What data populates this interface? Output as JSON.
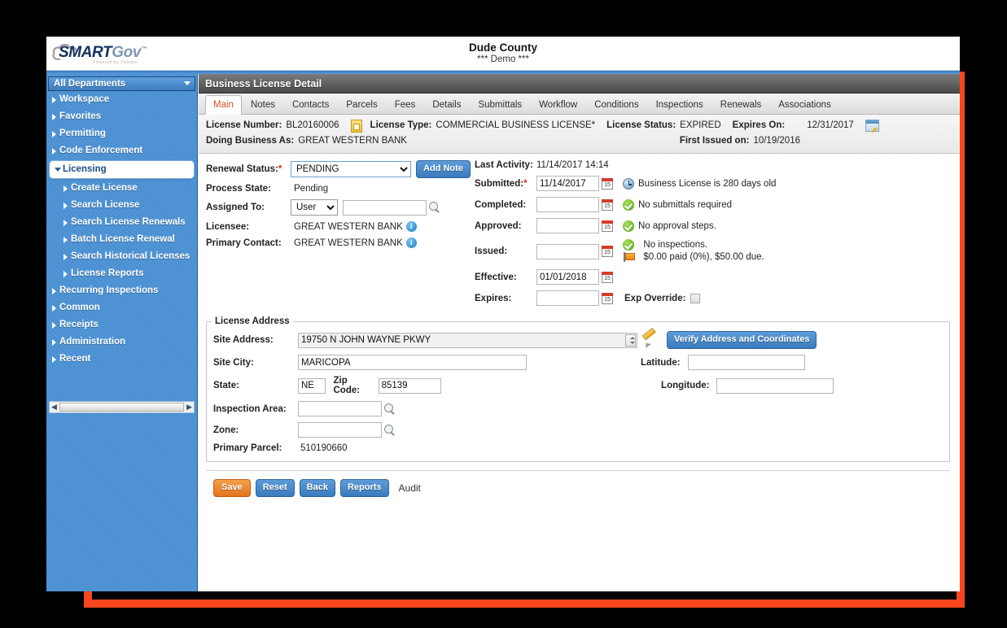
{
  "frame": {
    "accent_color": "#f9461c",
    "backdrop_color": "#000000"
  },
  "brand": {
    "logo_smart": "SMART",
    "logo_gov": "Gov",
    "logo_tm": "™",
    "logo_tagline": "Powered by Paladin"
  },
  "header": {
    "county": "Dude County",
    "demo": "*** Demo ***"
  },
  "sidebar": {
    "dept_selector": "All Departments",
    "items": [
      {
        "label": "Workspace",
        "level": 1,
        "state": "collapsed"
      },
      {
        "label": "Favorites",
        "level": 1,
        "state": "collapsed"
      },
      {
        "label": "Permitting",
        "level": 1,
        "state": "collapsed"
      },
      {
        "label": "Code Enforcement",
        "level": 1,
        "state": "collapsed"
      },
      {
        "label": "Licensing",
        "level": 1,
        "state": "expanded"
      },
      {
        "label": "Create License",
        "level": 2,
        "state": "collapsed"
      },
      {
        "label": "Search License",
        "level": 2,
        "state": "collapsed"
      },
      {
        "label": "Search License Renewals",
        "level": 2,
        "state": "collapsed"
      },
      {
        "label": "Batch License Renewal",
        "level": 2,
        "state": "collapsed"
      },
      {
        "label": "Search Historical Licenses",
        "level": 2,
        "state": "collapsed"
      },
      {
        "label": "License Reports",
        "level": 2,
        "state": "collapsed"
      },
      {
        "label": "Recurring Inspections",
        "level": 1,
        "state": "collapsed"
      },
      {
        "label": "Common",
        "level": 1,
        "state": "collapsed"
      },
      {
        "label": "Receipts",
        "level": 1,
        "state": "collapsed"
      },
      {
        "label": "Administration",
        "level": 1,
        "state": "collapsed"
      },
      {
        "label": "Recent",
        "level": 1,
        "state": "collapsed"
      }
    ]
  },
  "panel": {
    "title": "Business License Detail",
    "tabs": [
      {
        "label": "Main",
        "active": true
      },
      {
        "label": "Notes",
        "active": false
      },
      {
        "label": "Contacts",
        "active": false
      },
      {
        "label": "Parcels",
        "active": false
      },
      {
        "label": "Fees",
        "active": false
      },
      {
        "label": "Details",
        "active": false
      },
      {
        "label": "Submittals",
        "active": false
      },
      {
        "label": "Workflow",
        "active": false
      },
      {
        "label": "Conditions",
        "active": false
      },
      {
        "label": "Inspections",
        "active": false
      },
      {
        "label": "Renewals",
        "active": false
      },
      {
        "label": "Associations",
        "active": false
      }
    ]
  },
  "license_header": {
    "license_number_label": "License Number:",
    "license_number": "BL20160006",
    "license_type_label": "License Type:",
    "license_type": "COMMERCIAL BUSINESS LICENSE*",
    "license_status_label": "License Status:",
    "license_status": "EXPIRED",
    "expires_on_label": "Expires On:",
    "expires_on": "12/31/2017",
    "dba_label": "Doing Business As:",
    "dba": "GREAT WESTERN BANK",
    "first_issued_label": "First Issued on:",
    "first_issued": "10/19/2016"
  },
  "main_form": {
    "renewal_status_label": "Renewal Status:",
    "renewal_status_value": "PENDING",
    "renewal_status_options": [
      "PENDING"
    ],
    "add_note_button": "Add Note",
    "process_state_label": "Process State:",
    "process_state_value": "Pending",
    "assigned_to_label": "Assigned To:",
    "assigned_to_type": "User",
    "assigned_to_type_options": [
      "User"
    ],
    "assigned_to_value": "",
    "licensee_label": "Licensee:",
    "licensee_value": "GREAT WESTERN BANK",
    "primary_contact_label": "Primary Contact:",
    "primary_contact_value": "GREAT WESTERN BANK"
  },
  "dates": {
    "last_activity_label": "Last Activity:",
    "last_activity_value": "11/14/2017 14:14",
    "submitted_label": "Submitted:",
    "submitted_value": "11/14/2017",
    "submitted_note": "Business License is 280 days old",
    "completed_label": "Completed:",
    "completed_value": "",
    "completed_note": "No submittals required",
    "approved_label": "Approved:",
    "approved_value": "",
    "approved_note": "No approval steps.",
    "issued_label": "Issued:",
    "issued_value": "",
    "issued_note_1": "No inspections.",
    "issued_note_2": "$0.00 paid (0%), $50.00 due.",
    "effective_label": "Effective:",
    "effective_value": "01/01/2018",
    "expires_label": "Expires:",
    "expires_value": "",
    "exp_override_label": "Exp Override:",
    "exp_override_checked": false
  },
  "license_address": {
    "legend": "License Address",
    "site_address_label": "Site Address:",
    "site_address_value": "19750 N JOHN WAYNE PKWY",
    "verify_button": "Verify Address and Coordinates",
    "site_city_label": "Site City:",
    "site_city_value": "MARICOPA",
    "latitude_label": "Latitude:",
    "latitude_value": "",
    "longitude_label": "Longitude:",
    "longitude_value": "",
    "state_label": "State:",
    "state_value": "NE",
    "zip_label": "Zip Code:",
    "zip_value": "85139",
    "inspection_area_label": "Inspection Area:",
    "inspection_area_value": "",
    "zone_label": "Zone:",
    "zone_value": "",
    "primary_parcel_label": "Primary Parcel:",
    "primary_parcel_value": "510190660"
  },
  "actions": {
    "save": "Save",
    "reset": "Reset",
    "back": "Back",
    "reports": "Reports",
    "audit": "Audit"
  }
}
